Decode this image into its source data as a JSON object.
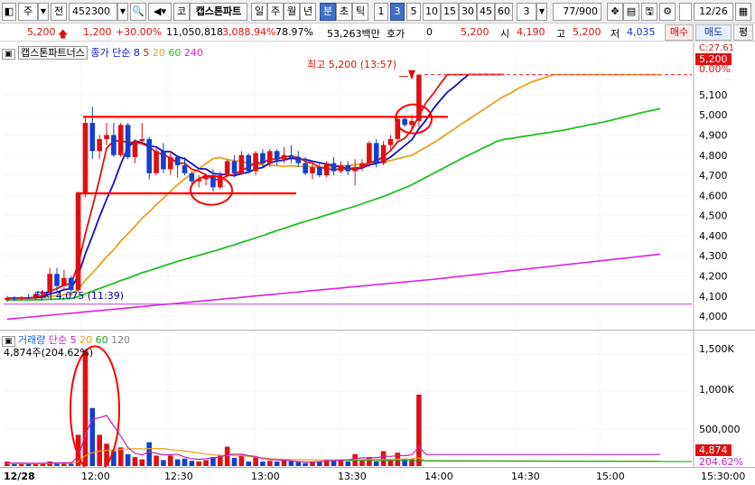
{
  "toolbar": {
    "market": "주",
    "prev_label": "전",
    "code": "452300",
    "co_label": "코",
    "stock_name": "캡스톤파트",
    "period_day": "일",
    "period_week": "주",
    "period_month": "월",
    "period_year": "년",
    "period_min": "분",
    "period_sec": "초",
    "period_tick": "틱",
    "intervals": [
      "1",
      "3",
      "5",
      "10",
      "15",
      "30",
      "45",
      "60"
    ],
    "interval_count": "3",
    "page_counter": "77/900",
    "date": "12/26"
  },
  "infobar": {
    "price": "5,200",
    "change": "1,200",
    "change_pct": "+30.00%",
    "volume": "11,050,818",
    "vol_pct": "3,088.94%",
    "turnover": "78.97%",
    "amount": "53,263백만",
    "quote_label": "호가",
    "quote_value": "0",
    "quote_price": "5,200",
    "open_label": "시",
    "open": "4,190",
    "high_label": "고",
    "high": "5,200",
    "low_label": "저",
    "low": "4,035",
    "buy": "매수",
    "sell": "매도",
    "eval": "평"
  },
  "price_legend": {
    "name": "캡스톤파트너스",
    "ma_label": "종가 단순",
    "ma_periods": [
      "8",
      "5",
      "20",
      "60",
      "240"
    ],
    "ma_colors": [
      "#1010d0",
      "#e01010",
      "#e8a020",
      "#20c020",
      "#e020e0"
    ]
  },
  "annotations": {
    "high": "최고 5,200 (13:57)",
    "low": "최저 4,075 (11:39)"
  },
  "price_axis": {
    "top_label": "C:27.61",
    "last_price": "5,200",
    "pct": "0.00%",
    "ticks": [
      "5,100",
      "5,000",
      "4,900",
      "4,800",
      "4,700",
      "4,600",
      "4,500",
      "4,400",
      "4,300",
      "4,200",
      "4,100",
      "4,000"
    ]
  },
  "vol_legend": {
    "title": "거래량",
    "ma_label": "단순",
    "ma_periods": [
      "5",
      "20",
      "60",
      "120"
    ],
    "current": "4,874주(204.62%)"
  },
  "vol_axis": {
    "ticks": [
      "1,500K",
      "1,000K",
      "500,000"
    ],
    "last_vol": "4,874",
    "last_pct": "204.62%"
  },
  "time_axis": {
    "date": "12/28",
    "ticks": [
      "12:00",
      "12:30",
      "13:00",
      "13:30",
      "14:00",
      "14:30",
      "15:00",
      "15:30:00"
    ]
  },
  "chart_data": {
    "type": "candlestick",
    "interval_minutes": 3,
    "y_range": [
      3960,
      5270
    ],
    "candles": [
      [
        4080,
        4100,
        4070,
        4090
      ],
      [
        4090,
        4100,
        4075,
        4085
      ],
      [
        4085,
        4100,
        4080,
        4095
      ],
      [
        4095,
        4110,
        4085,
        4090
      ],
      [
        4090,
        4120,
        4080,
        4110
      ],
      [
        4110,
        4130,
        4100,
        4120
      ],
      [
        4120,
        4240,
        4110,
        4210
      ],
      [
        4210,
        4240,
        4120,
        4150
      ],
      [
        4150,
        4230,
        4130,
        4190
      ],
      [
        4190,
        4200,
        4110,
        4130
      ],
      [
        4130,
        4620,
        4120,
        4610
      ],
      [
        4610,
        4990,
        4590,
        4960
      ],
      [
        4960,
        5040,
        4780,
        4820
      ],
      [
        4820,
        4900,
        4780,
        4880
      ],
      [
        4880,
        4960,
        4850,
        4900
      ],
      [
        4900,
        4960,
        4790,
        4800
      ],
      [
        4800,
        4960,
        4790,
        4950
      ],
      [
        4950,
        4960,
        4780,
        4790
      ],
      [
        4790,
        4880,
        4760,
        4870
      ],
      [
        4870,
        4960,
        4850,
        4880
      ],
      [
        4880,
        4890,
        4680,
        4710
      ],
      [
        4710,
        4840,
        4700,
        4820
      ],
      [
        4820,
        4860,
        4710,
        4730
      ],
      [
        4730,
        4820,
        4700,
        4790
      ],
      [
        4790,
        4800,
        4690,
        4750
      ],
      [
        4750,
        4790,
        4700,
        4710
      ],
      [
        4710,
        4720,
        4650,
        4670
      ],
      [
        4670,
        4700,
        4640,
        4680
      ],
      [
        4680,
        4710,
        4650,
        4700
      ],
      [
        4700,
        4730,
        4620,
        4640
      ],
      [
        4640,
        4720,
        4630,
        4700
      ],
      [
        4700,
        4780,
        4690,
        4770
      ],
      [
        4770,
        4800,
        4690,
        4710
      ],
      [
        4710,
        4820,
        4700,
        4800
      ],
      [
        4800,
        4810,
        4710,
        4720
      ],
      [
        4720,
        4820,
        4700,
        4810
      ],
      [
        4810,
        4830,
        4740,
        4760
      ],
      [
        4760,
        4830,
        4740,
        4820
      ],
      [
        4820,
        4830,
        4750,
        4780
      ],
      [
        4780,
        4840,
        4760,
        4800
      ],
      [
        4800,
        4850,
        4760,
        4790
      ],
      [
        4790,
        4820,
        4740,
        4760
      ],
      [
        4760,
        4790,
        4700,
        4710
      ],
      [
        4710,
        4760,
        4680,
        4740
      ],
      [
        4740,
        4760,
        4690,
        4700
      ],
      [
        4700,
        4770,
        4690,
        4760
      ],
      [
        4760,
        4790,
        4700,
        4720
      ],
      [
        4720,
        4770,
        4710,
        4750
      ],
      [
        4750,
        4770,
        4700,
        4720
      ],
      [
        4720,
        4780,
        4650,
        4740
      ],
      [
        4740,
        4780,
        4720,
        4760
      ],
      [
        4760,
        4870,
        4740,
        4860
      ],
      [
        4860,
        4880,
        4740,
        4760
      ],
      [
        4760,
        4870,
        4750,
        4850
      ],
      [
        4850,
        4900,
        4820,
        4880
      ],
      [
        4880,
        4990,
        4860,
        4980
      ],
      [
        4980,
        4990,
        4940,
        4950
      ],
      [
        4950,
        5000,
        4930,
        4970
      ],
      [
        4970,
        5200,
        4940,
        5200
      ]
    ],
    "volume": [
      60,
      40,
      30,
      25,
      35,
      30,
      60,
      40,
      40,
      30,
      420,
      1560,
      780,
      420,
      300,
      200,
      250,
      160,
      120,
      90,
      320,
      140,
      80,
      140,
      90,
      100,
      70,
      60,
      80,
      120,
      140,
      260,
      110,
      150,
      60,
      120,
      60,
      70,
      60,
      90,
      70,
      60,
      40,
      50,
      60,
      90,
      80,
      80,
      60,
      160,
      70,
      120,
      60,
      200,
      90,
      180,
      100,
      90,
      960
    ],
    "ma_volume_20": [
      30,
      32,
      32,
      31,
      31,
      32,
      35,
      36,
      37,
      36,
      60,
      140,
      180,
      200,
      210,
      215,
      225,
      230,
      235,
      230,
      235,
      235,
      235,
      220,
      210,
      200,
      190,
      175,
      160,
      150,
      145,
      145,
      145,
      140,
      130,
      120,
      110,
      100,
      95,
      90,
      88,
      86,
      85,
      84,
      82,
      82,
      83,
      84,
      85,
      84,
      85,
      86,
      86,
      88,
      90,
      92,
      94,
      96,
      110
    ],
    "ma_volume_5": [
      40,
      40,
      40,
      38,
      36,
      38,
      40,
      42,
      44,
      44,
      120,
      420,
      630,
      650,
      680,
      540,
      400,
      250,
      170,
      150,
      190,
      170,
      150,
      150,
      160,
      120,
      100,
      90,
      100,
      110,
      120,
      150,
      160,
      160,
      140,
      130,
      100,
      90,
      80,
      80,
      70,
      60,
      55,
      55,
      60,
      70,
      70,
      80,
      80,
      100,
      110,
      110,
      110,
      130,
      130,
      140,
      140,
      150,
      260
    ]
  }
}
